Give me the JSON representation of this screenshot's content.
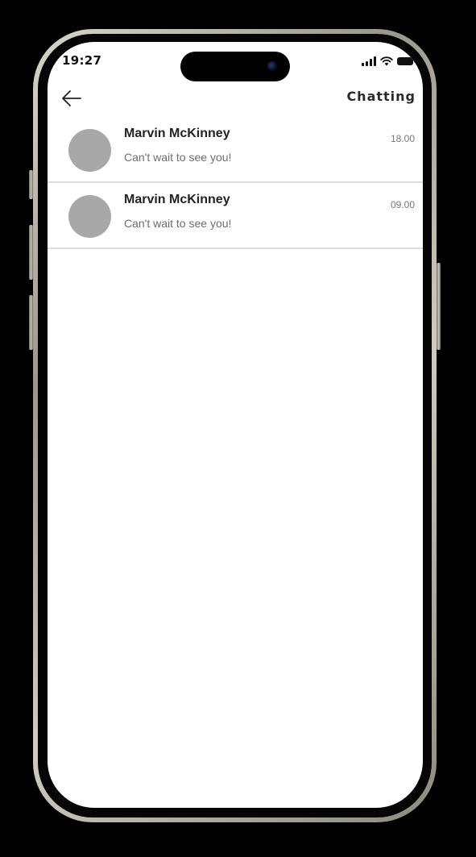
{
  "status_bar": {
    "time": "19:27"
  },
  "header": {
    "back_icon": "arrow-left-icon",
    "title": "Chatting"
  },
  "chats": [
    {
      "name": "Marvin McKinney",
      "preview": "Can't wait to see you!",
      "time": "18.00"
    },
    {
      "name": "Marvin McKinney",
      "preview": "Can't wait to see you!",
      "time": "09.00"
    }
  ],
  "colors": {
    "background": "#000000",
    "screen": "#ffffff",
    "avatar_placeholder": "#a8a8a8",
    "divider": "#dcdcdc",
    "frame": "#c9c5ba"
  }
}
